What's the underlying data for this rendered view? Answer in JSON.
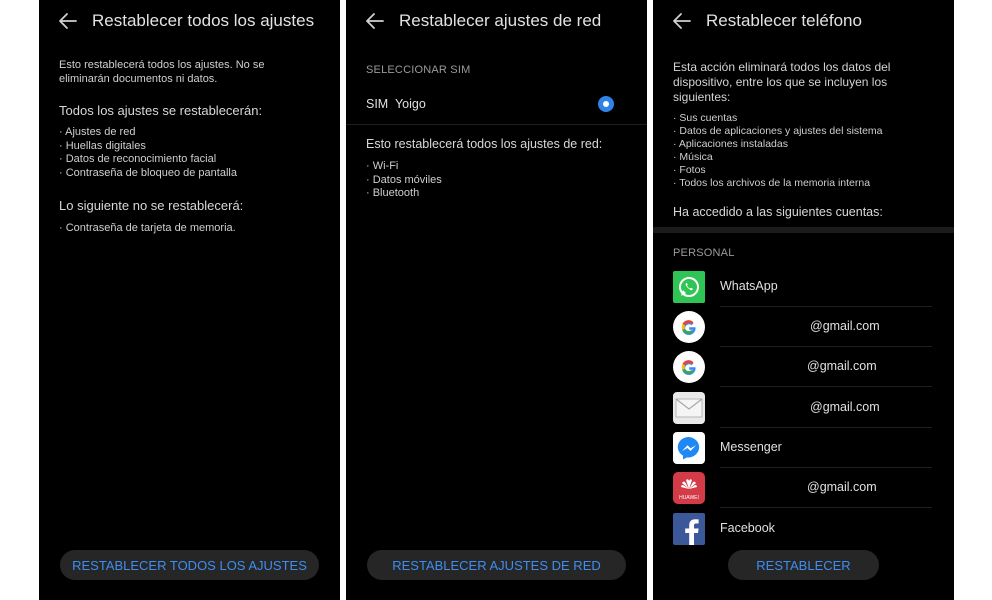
{
  "screens": {
    "reset_all": {
      "title": "Restablecer todos los ajustes",
      "description": "Esto restablecerá todos los ajustes. No se eliminarán documentos ni datos.",
      "desc_line1": "Esto restablecerá todos los ajustes. No se",
      "desc_line2": "eliminarán documentos ni datos.",
      "reset_heading": "Todos los ajustes se restablecerán:",
      "reset_items": [
        "· Ajustes de red",
        "· Huellas digitales",
        "· Datos de reconocimiento facial",
        "· Contraseña de bloqueo de pantalla"
      ],
      "keep_heading": "Lo siguiente no se restablecerá:",
      "keep_items": [
        "· Contraseña de tarjeta de memoria."
      ],
      "button": "RESTABLECER TODOS LOS AJUSTES"
    },
    "reset_network": {
      "title": "Restablecer ajustes de red",
      "select_sim": "SELECCIONAR SIM",
      "sim_label": "SIM  Yoigo",
      "heading": "Esto restablecerá todos los ajustes de red:",
      "items": [
        "· Wi-Fi",
        "· Datos móviles",
        "· Bluetooth"
      ],
      "button": "RESTABLECER AJUSTES DE RED"
    },
    "reset_phone": {
      "title": "Restablecer teléfono",
      "desc_lines": [
        "Esta acción eliminará todos los datos del",
        "dispositivo, entre los que se incluyen los",
        "siguientes:"
      ],
      "items": [
        "· Sus cuentas",
        "· Datos de aplicaciones y ajustes del sistema",
        "· Aplicaciones instaladas",
        "· Música",
        "· Fotos",
        "· Todos los archivos de la memoria interna"
      ],
      "accounts_heading": "Ha accedido a las siguientes cuentas:",
      "personal": "PERSONAL",
      "accounts": [
        {
          "icon": "whatsapp-icon",
          "label": "WhatsApp"
        },
        {
          "icon": "google-icon",
          "label": "@gmail.com"
        },
        {
          "icon": "google-icon",
          "label": "@gmail.com"
        },
        {
          "icon": "mail-icon",
          "label": "@gmail.com"
        },
        {
          "icon": "messenger-icon",
          "label": "Messenger"
        },
        {
          "icon": "huawei-icon",
          "label": "@gmail.com",
          "icon_text": "HUAWEI"
        },
        {
          "icon": "facebook-icon",
          "label": "Facebook"
        }
      ],
      "button": "RESTABLECER"
    }
  },
  "colors": {
    "background": "#000000",
    "accent": "#3d8ef0",
    "button_bg": "#262626",
    "radio": "#2f83e6"
  }
}
